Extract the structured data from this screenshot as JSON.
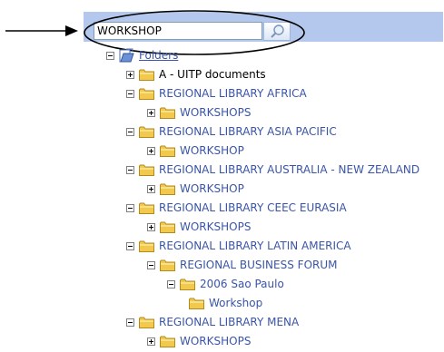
{
  "search": {
    "value": "WORKSHOP"
  },
  "tree": [
    {
      "label": "Folders",
      "level": 0,
      "expander": "minus",
      "icon": "root-folders-icon",
      "style": "link"
    },
    {
      "label": "A - UITP documents",
      "level": 1,
      "expander": "plus",
      "icon": "folder-icon",
      "style": "dark"
    },
    {
      "label": "REGIONAL LIBRARY AFRICA",
      "level": 1,
      "expander": "minus",
      "icon": "folder-icon"
    },
    {
      "label": "WORKSHOPS",
      "level": 2,
      "expander": "plus",
      "icon": "folder-icon"
    },
    {
      "label": "REGIONAL LIBRARY ASIA PACIFIC",
      "level": 1,
      "expander": "minus",
      "icon": "folder-icon"
    },
    {
      "label": "WORKSHOP",
      "level": 2,
      "expander": "plus",
      "icon": "folder-icon"
    },
    {
      "label": "REGIONAL LIBRARY AUSTRALIA - NEW ZEALAND",
      "level": 1,
      "expander": "minus",
      "icon": "folder-icon"
    },
    {
      "label": "WORKSHOP",
      "level": 2,
      "expander": "plus",
      "icon": "folder-icon"
    },
    {
      "label": "REGIONAL LIBRARY CEEC EURASIA",
      "level": 1,
      "expander": "minus",
      "icon": "folder-icon"
    },
    {
      "label": "WORKSHOPS",
      "level": 2,
      "expander": "plus",
      "icon": "folder-icon"
    },
    {
      "label": "REGIONAL LIBRARY LATIN AMERICA",
      "level": 1,
      "expander": "minus",
      "icon": "folder-icon"
    },
    {
      "label": "REGIONAL BUSINESS FORUM",
      "level": 2,
      "expander": "minus",
      "icon": "folder-icon"
    },
    {
      "label": "2006 Sao Paulo",
      "level": 3,
      "expander": "minus",
      "icon": "folder-icon"
    },
    {
      "label": "Workshop",
      "level": 4,
      "expander": "none",
      "icon": "folder-icon"
    },
    {
      "label": "REGIONAL LIBRARY MENA",
      "level": 1,
      "expander": "minus",
      "icon": "folder-icon"
    },
    {
      "label": "WORKSHOPS",
      "level": 2,
      "expander": "plus",
      "icon": "folder-icon"
    }
  ],
  "colors": {
    "header_band": "#b4c7ec",
    "link_text": "#3a55a8",
    "folder": "#f2c94c"
  }
}
